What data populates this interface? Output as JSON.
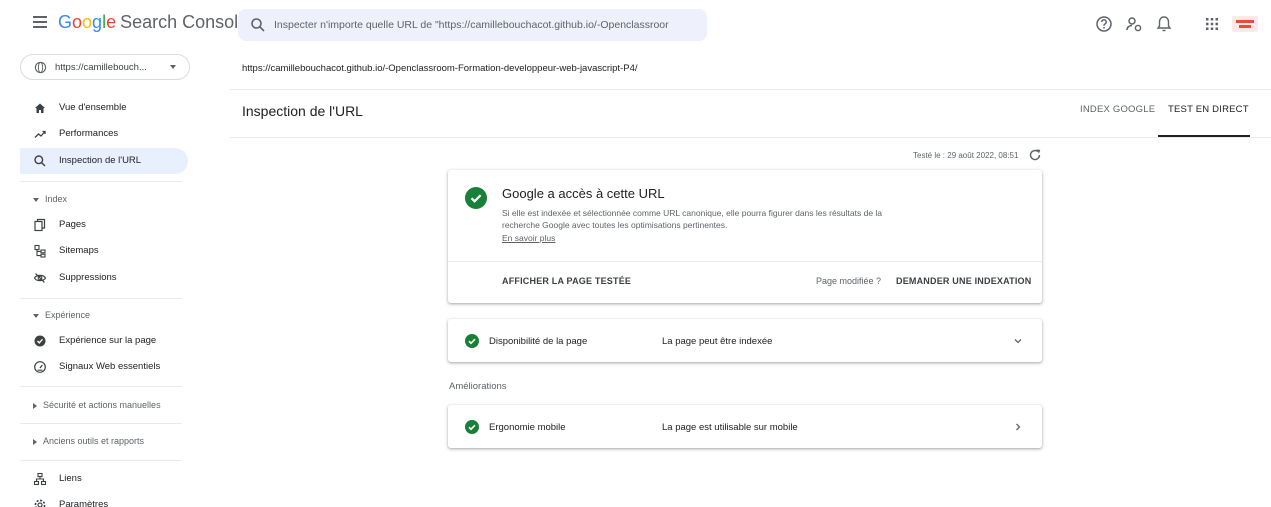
{
  "colors": {
    "accent": "#1a73e8",
    "success": "#188038",
    "active_bg": "#e8f0fe"
  },
  "header": {
    "logo": {
      "google": [
        "G",
        "o",
        "o",
        "g",
        "l",
        "e"
      ],
      "product": "Search Console"
    },
    "search": {
      "placeholder": "Inspecter n'importe quelle URL de \"https://camillebouchacot.github.io/-Openclassroor"
    },
    "icons": [
      "help-icon",
      "account-admin-icon",
      "notifications-icon",
      "apps-grid-icon",
      "brand-logo"
    ]
  },
  "property": {
    "label": "https://camillebouch..."
  },
  "sidebar": {
    "items_top": [
      {
        "label": "Vue d'ensemble",
        "icon": "home-icon"
      },
      {
        "label": "Performances",
        "icon": "trending-icon"
      },
      {
        "label": "Inspection de l'URL",
        "icon": "search-icon",
        "active": true
      }
    ],
    "index_section": "Index",
    "index_items": [
      {
        "label": "Pages",
        "icon": "pages-icon"
      },
      {
        "label": "Sitemaps",
        "icon": "sitemap-icon"
      },
      {
        "label": "Suppressions",
        "icon": "visibility-off-icon"
      }
    ],
    "experience_section": "Expérience",
    "experience_items": [
      {
        "label": "Expérience sur la page",
        "icon": "page-experience-icon"
      },
      {
        "label": "Signaux Web essentiels",
        "icon": "speed-icon"
      }
    ],
    "security_section": "Sécurité et actions manuelles",
    "legacy_section": "Anciens outils et rapports",
    "bottom_items": [
      {
        "label": "Liens",
        "icon": "links-icon"
      },
      {
        "label": "Paramètres",
        "icon": "settings-icon"
      }
    ]
  },
  "main": {
    "url": "https://camillebouchacot.github.io/-Openclassroom-Formation-developpeur-web-javascript-P4/",
    "title": "Inspection de l'URL",
    "tabs": [
      {
        "label": "INDEX GOOGLE",
        "active": false
      },
      {
        "label": "TEST EN DIRECT",
        "active": true
      }
    ],
    "tested": "Testé le : 29 août 2022, 08:51",
    "status_card": {
      "title": "Google a accès à cette URL",
      "description": "Si elle est indexée et sélectionnée comme URL canonique, elle pourra figurer dans les résultats de la recherche Google avec toutes les optimisations pertinentes.",
      "link": "En savoir plus",
      "view_tested_page": "AFFICHER LA PAGE TESTÉE",
      "page_modified": "Page modifiée ?",
      "request_indexing": "DEMANDER UNE INDEXATION"
    },
    "availability": {
      "label": "Disponibilité de la page",
      "value": "La page peut être indexée"
    },
    "enhancements_heading": "Améliorations",
    "mobile": {
      "label": "Ergonomie mobile",
      "value": "La page est utilisable sur mobile"
    }
  }
}
